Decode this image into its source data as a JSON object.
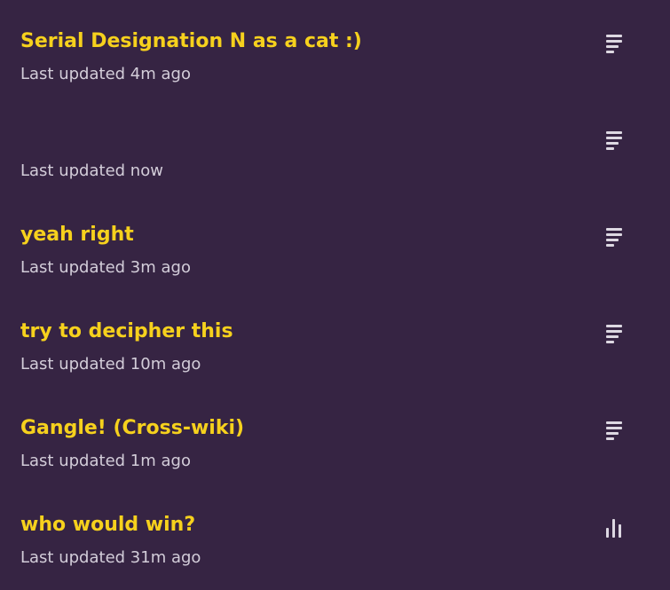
{
  "items": [
    {
      "title": "Serial Designation N as a cat :)",
      "updated": "Last updated 4m ago",
      "icon": "lines-icon"
    },
    {
      "title": "",
      "updated": "Last updated now",
      "icon": "lines-icon"
    },
    {
      "title": "yeah right",
      "updated": "Last updated 3m ago",
      "icon": "lines-icon"
    },
    {
      "title": "try to decipher this",
      "updated": "Last updated 10m ago",
      "icon": "lines-icon"
    },
    {
      "title": "Gangle! (Cross-wiki)",
      "updated": "Last updated 1m ago",
      "icon": "lines-icon"
    },
    {
      "title": "who would win?",
      "updated": "Last updated 31m ago",
      "icon": "bar-chart-icon"
    }
  ],
  "colors": {
    "background": "#362443",
    "title": "#f6d11d",
    "subtitle": "#d3cdd9",
    "icon": "#ddd8e2"
  }
}
